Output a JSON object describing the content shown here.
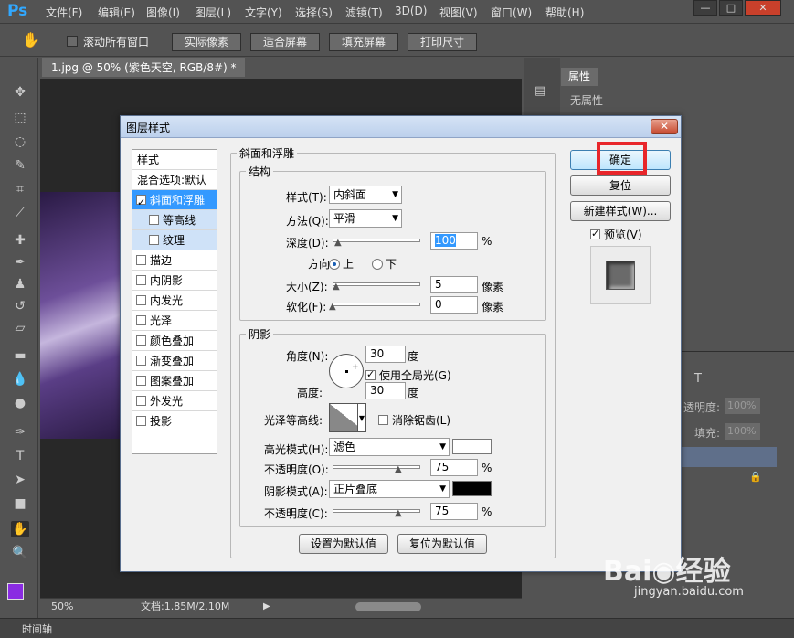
{
  "app": {
    "logo": "Ps"
  },
  "menu": [
    "文件(F)",
    "编辑(E)",
    "图像(I)",
    "图层(L)",
    "文字(Y)",
    "选择(S)",
    "滤镜(T)",
    "3D(D)",
    "视图(V)",
    "窗口(W)",
    "帮助(H)"
  ],
  "window_controls": [
    "—",
    "□",
    "✕"
  ],
  "options": {
    "scroll_all": "滚动所有窗口",
    "actual_pixels": "实际像素",
    "fit_screen": "适合屏幕",
    "fill_screen": "填充屏幕",
    "print_size": "打印尺寸"
  },
  "document": {
    "tab": "1.jpg @ 50% (紫色天空, RGB/8#) *",
    "close": "×"
  },
  "status": {
    "zoom": "50%",
    "doc_size": "文档:1.85M/2.10M"
  },
  "timeline": {
    "label": "时间轴"
  },
  "properties": {
    "tab": "属性",
    "content": "无属性"
  },
  "layers": {
    "opacity_label": "透明度:",
    "opacity_value": "100%",
    "fill_label": "填充:",
    "fill_value": "100%"
  },
  "dialog": {
    "title": "图层样式",
    "close": "✕",
    "styles_header": "样式",
    "blend_options": "混合选项:默认",
    "style_items": [
      {
        "label": "斜面和浮雕",
        "checked": true
      },
      {
        "label": "等高线",
        "checked": false
      },
      {
        "label": "纹理",
        "checked": false
      },
      {
        "label": "描边",
        "checked": false
      },
      {
        "label": "内阴影",
        "checked": false
      },
      {
        "label": "内发光",
        "checked": false
      },
      {
        "label": "光泽",
        "checked": false
      },
      {
        "label": "颜色叠加",
        "checked": false
      },
      {
        "label": "渐变叠加",
        "checked": false
      },
      {
        "label": "图案叠加",
        "checked": false
      },
      {
        "label": "外发光",
        "checked": false
      },
      {
        "label": "投影",
        "checked": false
      }
    ],
    "bevel": {
      "title": "斜面和浮雕",
      "structure": "结构",
      "style_label": "样式(T):",
      "style_value": "内斜面",
      "technique_label": "方法(Q):",
      "technique_value": "平滑",
      "depth_label": "深度(D):",
      "depth_value": "100",
      "depth_unit": "%",
      "direction_label": "方向:",
      "dir_up": "上",
      "dir_down": "下",
      "size_label": "大小(Z):",
      "size_value": "5",
      "size_unit": "像素",
      "soften_label": "软化(F):",
      "soften_value": "0",
      "soften_unit": "像素"
    },
    "shading": {
      "title": "阴影",
      "angle_label": "角度(N):",
      "angle_value": "30",
      "angle_unit": "度",
      "global_light": "使用全局光(G)",
      "altitude_label": "高度:",
      "altitude_value": "30",
      "altitude_unit": "度",
      "gloss_label": "光泽等高线:",
      "antialias": "消除锯齿(L)",
      "highlight_label": "高光模式(H):",
      "highlight_value": "滤色",
      "highlight_color": "#ffffff",
      "hl_opacity_label": "不透明度(O):",
      "hl_opacity_value": "75",
      "hl_opacity_unit": "%",
      "shadow_label": "阴影模式(A):",
      "shadow_value": "正片叠底",
      "shadow_color": "#000000",
      "sh_opacity_label": "不透明度(C):",
      "sh_opacity_value": "75",
      "sh_opacity_unit": "%"
    },
    "make_default": "设置为默认值",
    "reset_default": "复位为默认值",
    "ok": "确定",
    "reset": "复位",
    "new_style": "新建样式(W)...",
    "preview": "预览(V)"
  },
  "watermark": {
    "logo": "Bai◉经验",
    "url": "jingyan.baidu.com"
  }
}
